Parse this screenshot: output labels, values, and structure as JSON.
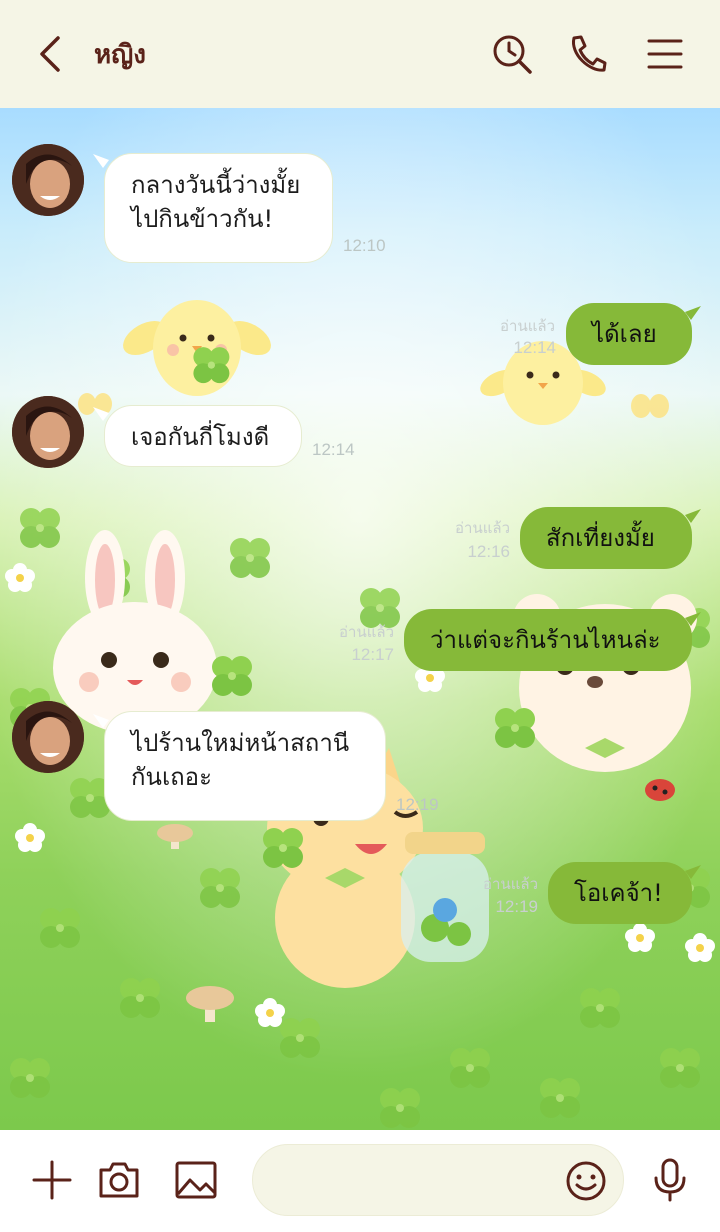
{
  "header": {
    "title": "หญิง"
  },
  "messages": [
    {
      "side": "in",
      "lines": [
        "กลางวันนี้ว่างมั้ย",
        "ไปกินข้าวกัน!"
      ],
      "time": "12:10"
    },
    {
      "side": "out",
      "text": "ได้เลย",
      "read": "อ่านแล้ว",
      "time": "12:14"
    },
    {
      "side": "in",
      "text": "เจอกันกี่โมงดี",
      "time": "12:14"
    },
    {
      "side": "out",
      "text": "สักเที่ยงมั้ย",
      "read": "อ่านแล้ว",
      "time": "12:16"
    },
    {
      "side": "out",
      "text": "ว่าแต่จะกินร้านไหนล่ะ",
      "read": "อ่านแล้ว",
      "time": "12:17"
    },
    {
      "side": "in",
      "lines": [
        "ไปร้านใหม่หน้าสถานี",
        "กันเถอะ"
      ],
      "time": "12:19"
    },
    {
      "side": "out",
      "text": "โอเคจ้า!",
      "read": "อ่านแล้ว",
      "time": "12:19"
    }
  ],
  "footer": {
    "input_placeholder": ""
  },
  "colors": {
    "header_bg": "#f5f5e6",
    "accent": "#5a2219",
    "outgoing_bubble": "#86b939"
  }
}
